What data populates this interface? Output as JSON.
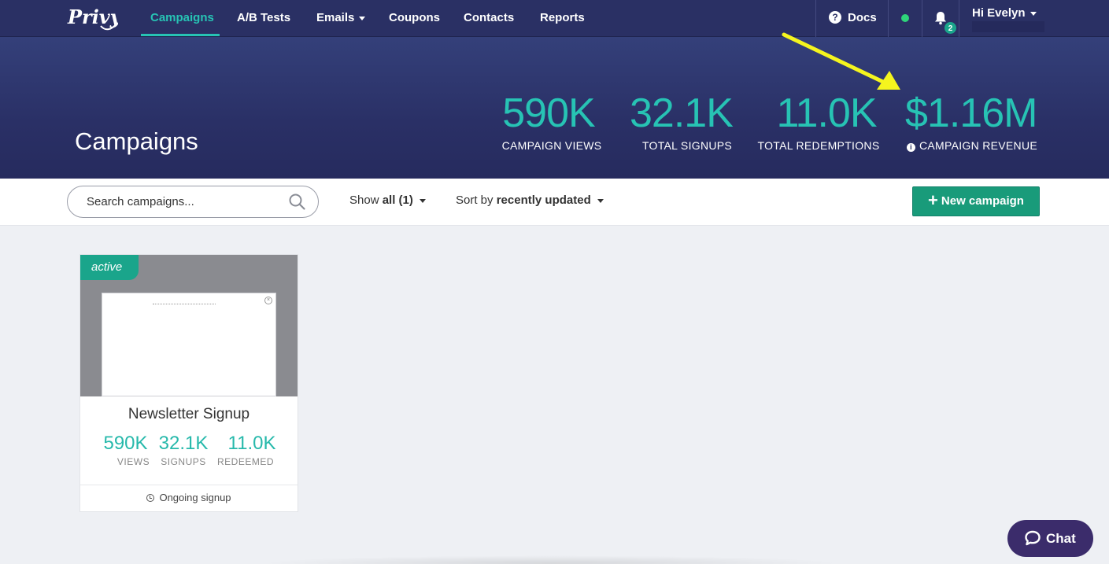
{
  "nav": {
    "brand": "Privy",
    "items": [
      {
        "label": "Campaigns",
        "active": true
      },
      {
        "label": "A/B Tests"
      },
      {
        "label": "Emails",
        "has_caret": true
      },
      {
        "label": "Coupons"
      },
      {
        "label": "Contacts"
      },
      {
        "label": "Reports"
      }
    ],
    "docs_label": "Docs",
    "docs_icon": "question-circle-icon",
    "status_color": "#2ed47a",
    "notifications_count": "2",
    "user_greeting": "Hi Evelyn"
  },
  "hero": {
    "title": "Campaigns",
    "stats": [
      {
        "value": "590K",
        "label": "CAMPAIGN VIEWS"
      },
      {
        "value": "32.1K",
        "label": "TOTAL SIGNUPS"
      },
      {
        "value": "11.0K",
        "label": "TOTAL REDEMPTIONS"
      },
      {
        "value": "$1.16M",
        "label": "CAMPAIGN REVENUE",
        "info_icon": true
      }
    ],
    "annotation_arrow_color": "#f5f51e"
  },
  "toolbar": {
    "search_placeholder": "Search campaigns...",
    "show_prefix": "Show",
    "show_value": "all (1)",
    "sort_prefix": "Sort by",
    "sort_value": "recently updated",
    "new_campaign_label": "New campaign"
  },
  "campaigns": [
    {
      "status": "active",
      "title": "Newsletter Signup",
      "stats": [
        {
          "value": "590K",
          "label": "VIEWS"
        },
        {
          "value": "32.1K",
          "label": "SIGNUPS"
        },
        {
          "value": "11.0K",
          "label": "REDEEMED"
        }
      ],
      "footer": "Ongoing signup"
    }
  ],
  "chat": {
    "label": "Chat"
  },
  "colors": {
    "nav_bg": "#2a3064",
    "accent_teal": "#27c3b4",
    "button_green": "#199b7a",
    "chat_purple": "#3b2c6b"
  }
}
